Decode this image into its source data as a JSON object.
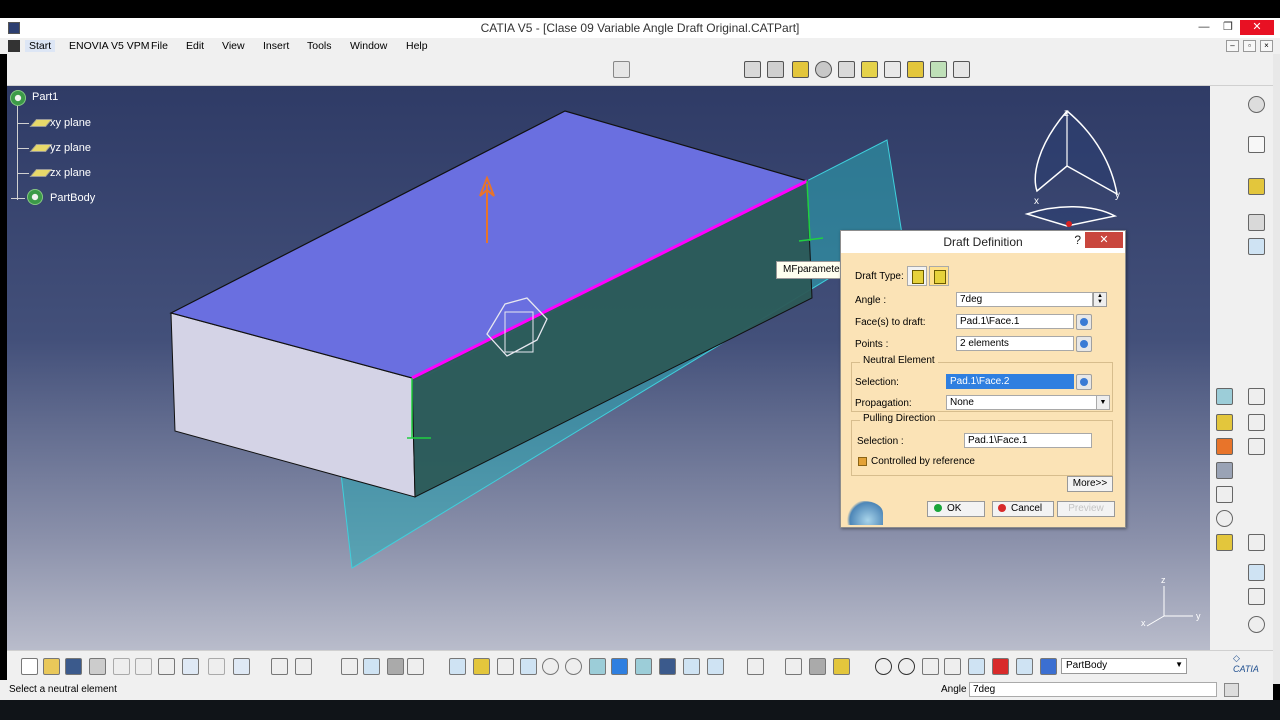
{
  "window": {
    "title": "CATIA V5 - [Clase 09 Variable Angle Draft Original.CATPart]",
    "minimize": "—",
    "maximize": "❐",
    "close": "✕"
  },
  "menu": {
    "items": [
      "Start",
      "ENOVIA V5 VPM",
      "File",
      "Edit",
      "View",
      "Insert",
      "Tools",
      "Window",
      "Help"
    ]
  },
  "tree": {
    "root": "Part1",
    "children": [
      "xy plane",
      "yz plane",
      "zx plane",
      "PartBody"
    ]
  },
  "tooltip": "MFparameter.3",
  "dialog": {
    "title": "Draft Definition",
    "help": "?",
    "draft_type_label": "Draft Type:",
    "angle_label": "Angle :",
    "angle_value": "7deg",
    "faces_label": "Face(s) to draft:",
    "faces_value": "Pad.1\\Face.1",
    "points_label": "Points :",
    "points_value": "2 elements",
    "neutral_group": "Neutral Element",
    "selection_label": "Selection:",
    "selection_value": "Pad.1\\Face.2",
    "propagation_label": "Propagation:",
    "propagation_value": "None",
    "pulling_group": "Pulling Direction",
    "pulling_selection_label": "Selection :",
    "pulling_selection_value": "Pad.1\\Face.1",
    "controlled_label": "Controlled by reference",
    "more_button": "More>>",
    "ok_button": "OK",
    "cancel_button": "Cancel",
    "preview_button": "Preview"
  },
  "axes": {
    "x": "x",
    "y": "y",
    "z": "z"
  },
  "bottom_combo": "PartBody",
  "status": {
    "message": "Select a neutral element",
    "param_name": "Angle",
    "param_value": "7deg"
  },
  "colors": {
    "viewport_top": "#2f3b66",
    "top_face": "#6a6fe0",
    "highlight_edge": "#ff00ff",
    "plane": "#2aa9b4",
    "dialog_bg": "#fbe3b6"
  }
}
